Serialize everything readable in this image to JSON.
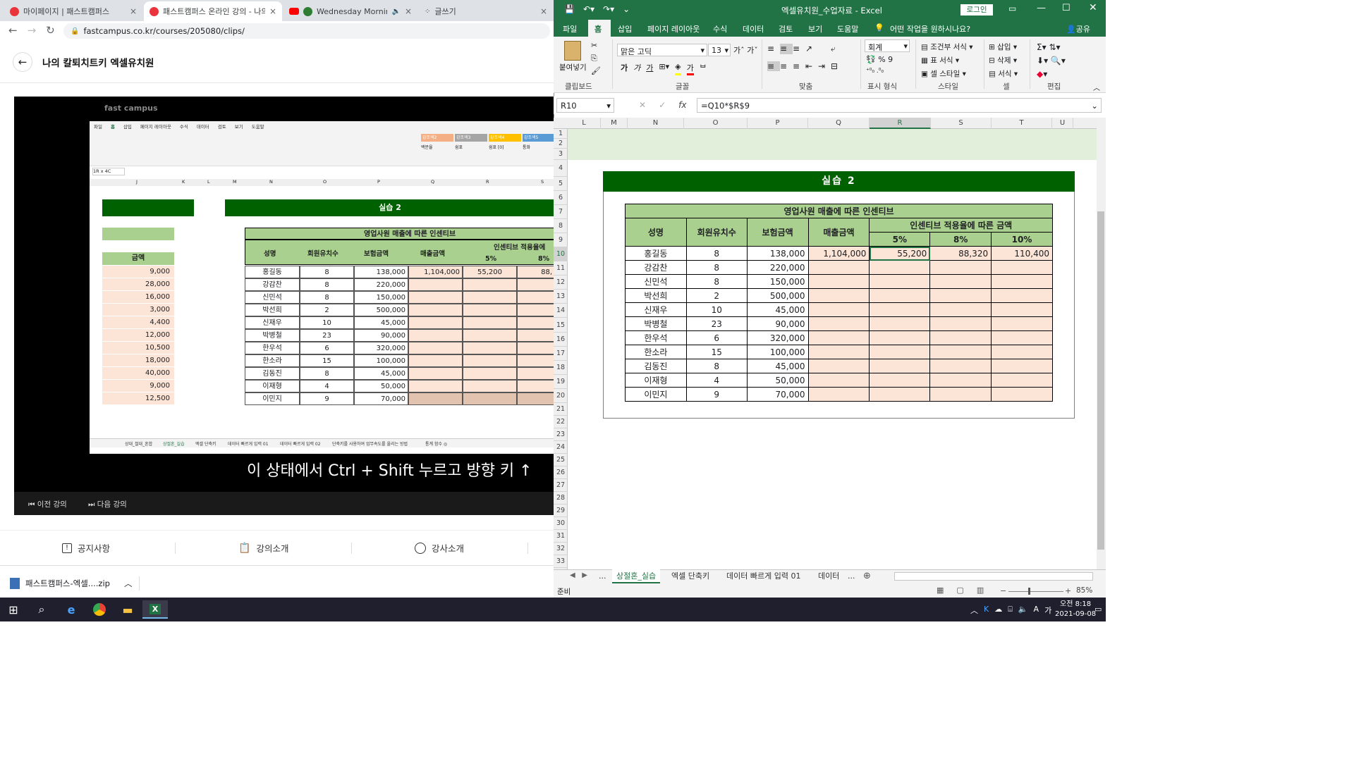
{
  "browser": {
    "tabs": [
      {
        "title": "마이페이지 | 패스트캠퍼스",
        "close": "×"
      },
      {
        "title": "패스트캠퍼스 온라인 강의 - 나의",
        "close": "×"
      },
      {
        "title": "Wednesday Morning Jazz",
        "close": "×"
      },
      {
        "title": "글쓰기",
        "close": "×"
      }
    ],
    "url": "fastcampus.co.kr/courses/205080/clips/",
    "course_title": "나의 칼퇴치트키 엑셀유치원",
    "video": {
      "logo": "fast campus",
      "subtitle": "이 상태에서 Ctrl + Shift 누르고 방향 키 ↑",
      "prev": "이전 강의",
      "next": "다음 강의",
      "inner": {
        "menu": [
          "파일",
          "홈",
          "삽입",
          "페이지 레이아웃",
          "수식",
          "데이터",
          "검토",
          "보기",
          "도움말"
        ],
        "namebox": "1R x 4C",
        "cols": [
          "J",
          "K",
          "L",
          "M",
          "N",
          "O",
          "P",
          "Q",
          "R",
          "S"
        ],
        "rows": [
          "4",
          "5",
          "6",
          "7",
          "8",
          "9",
          "10",
          "11",
          "12",
          "13",
          "14",
          "15",
          "16",
          "17",
          "18",
          "19",
          "20",
          "21",
          "22",
          "23"
        ],
        "banner": "실습 2",
        "left_header": "금액",
        "left_values": [
          "9,000",
          "28,000",
          "16,000",
          "3,000",
          "4,400",
          "12,000",
          "10,500",
          "18,000",
          "40,000",
          "9,000",
          "12,500"
        ],
        "table_title": "영업사원 매출에 따른 인센티브",
        "headers": [
          "성명",
          "회원유치수",
          "보험금액",
          "매출금액",
          "인센티브 적용율에",
          "5%",
          "8%"
        ],
        "first_row": [
          "1,104,000",
          "55,200",
          "88,"
        ],
        "tabs": [
          "상대_절대_혼합",
          "상절혼_실습",
          "엑셀 단축키",
          "데이터 빠르게 입력 01",
          "데이터 빠르게 입력 02",
          "단축키를 사용하여 업무속도를 올리는 방법",
          "통계 함수 ◎"
        ],
        "styles": [
          "강조색2",
          "강조색3",
          "강조색4",
          "강조색5",
          "백분율",
          "쉼표",
          "쉼표 [0]",
          "통화"
        ]
      }
    },
    "bottom_tabs": [
      "공지사항",
      "강의소개",
      "강사소개"
    ],
    "download": "패스트캠퍼스-엑셀....zip"
  },
  "excel": {
    "title": "엑셀유치원_수업자료 - Excel",
    "login": "로그인",
    "menu": [
      "파일",
      "홈",
      "삽입",
      "페이지 레이아웃",
      "수식",
      "데이터",
      "검토",
      "보기",
      "도움말"
    ],
    "tell_me": "어떤 작업을 원하시나요?",
    "share": "공유",
    "ribbon": {
      "paste": "붙여넣기",
      "font_name": "맑은 고딕",
      "font_size": "13",
      "number_format": "회계",
      "cond_format": "조건부 서식",
      "table_format": "표 서식",
      "cell_style": "셀 스타일",
      "insert": "삽입",
      "delete": "삭제",
      "format": "서식",
      "groups": [
        "클립보드",
        "글꼴",
        "맞춤",
        "표시 형식",
        "스타일",
        "셀",
        "편집"
      ]
    },
    "name_box": "R10",
    "formula": "=Q10*$R$9",
    "columns": [
      "L",
      "M",
      "N",
      "O",
      "P",
      "Q",
      "R",
      "S",
      "T",
      "U"
    ],
    "rows": [
      "1",
      "2",
      "3",
      "4",
      "5",
      "6",
      "7",
      "8",
      "9",
      "10",
      "11",
      "12",
      "13",
      "14",
      "15",
      "16",
      "17",
      "18",
      "19",
      "20",
      "21",
      "22",
      "23",
      "24",
      "25",
      "26",
      "27",
      "28",
      "29",
      "30",
      "31",
      "32",
      "33"
    ],
    "banner": "실습 2",
    "table": {
      "title": "영업사원 매출에 따른 인센티브",
      "headers": [
        "성명",
        "회원유치수",
        "보험금액",
        "매출금액"
      ],
      "incentive_header": "인센티브 적용율에 따른 금액",
      "rates": [
        "5%",
        "8%",
        "10%"
      ],
      "rows": [
        {
          "name": "홍길동",
          "count": "8",
          "amount": "138,000",
          "sales": "1,104,000",
          "r5": "55,200",
          "r8": "88,320",
          "r10": "110,400"
        },
        {
          "name": "강감찬",
          "count": "8",
          "amount": "220,000",
          "sales": "",
          "r5": "",
          "r8": "",
          "r10": ""
        },
        {
          "name": "신민석",
          "count": "8",
          "amount": "150,000",
          "sales": "",
          "r5": "",
          "r8": "",
          "r10": ""
        },
        {
          "name": "박선희",
          "count": "2",
          "amount": "500,000",
          "sales": "",
          "r5": "",
          "r8": "",
          "r10": ""
        },
        {
          "name": "신재우",
          "count": "10",
          "amount": "45,000",
          "sales": "",
          "r5": "",
          "r8": "",
          "r10": ""
        },
        {
          "name": "박병철",
          "count": "23",
          "amount": "90,000",
          "sales": "",
          "r5": "",
          "r8": "",
          "r10": ""
        },
        {
          "name": "한우석",
          "count": "6",
          "amount": "320,000",
          "sales": "",
          "r5": "",
          "r8": "",
          "r10": ""
        },
        {
          "name": "한소라",
          "count": "15",
          "amount": "100,000",
          "sales": "",
          "r5": "",
          "r8": "",
          "r10": ""
        },
        {
          "name": "김동진",
          "count": "8",
          "amount": "45,000",
          "sales": "",
          "r5": "",
          "r8": "",
          "r10": ""
        },
        {
          "name": "이재형",
          "count": "4",
          "amount": "50,000",
          "sales": "",
          "r5": "",
          "r8": "",
          "r10": ""
        },
        {
          "name": "이민지",
          "count": "9",
          "amount": "70,000",
          "sales": "",
          "r5": "",
          "r8": "",
          "r10": ""
        }
      ]
    },
    "sheet_tabs": [
      "...",
      "상절혼_실습",
      "엑셀 단축키",
      "데이터 빠르게 입력 01",
      "데이터",
      "..."
    ],
    "status": "준비",
    "zoom": "85%"
  },
  "taskbar": {
    "time": "오전 8:18",
    "date": "2021-09-08",
    "ime": "A"
  }
}
